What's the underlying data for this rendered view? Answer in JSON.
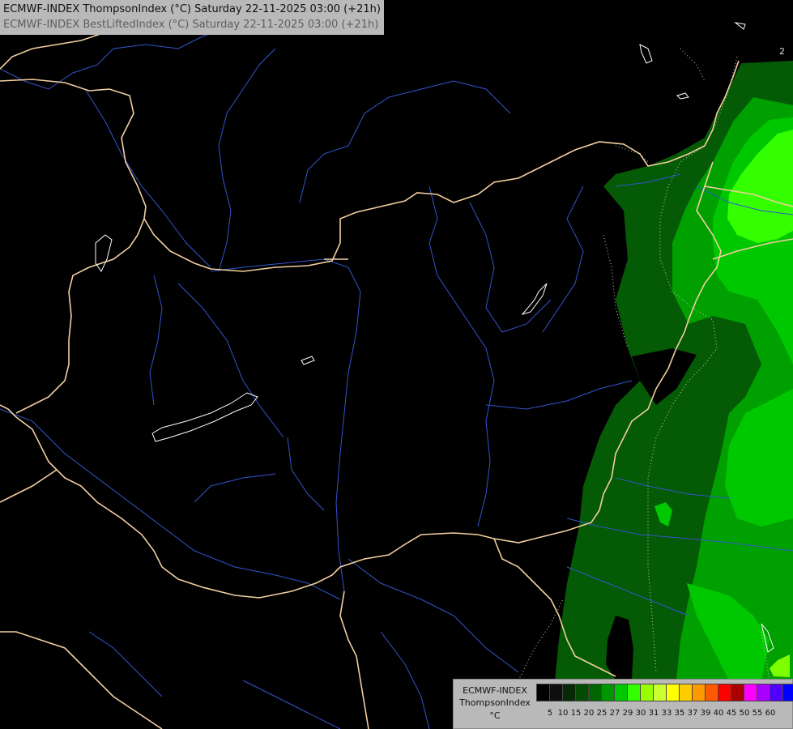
{
  "header": {
    "line1": "ECMWF-INDEX ThompsonIndex (°C) Saturday 22-11-2025 03:00 (+21h)",
    "line2": "ECMWF-INDEX BestLiftedIndex (°C) Saturday 22-11-2025 03:00 (+21h)"
  },
  "map": {
    "background_color": "#000000",
    "border_color": "#f2cfa0",
    "river_color": "#3355cc",
    "lake_outline_color": "#ffffff",
    "contour_label": "2"
  },
  "legend": {
    "source": "ECMWF-INDEX",
    "parameter": "ThompsonIndex",
    "unit": "°C",
    "ticks": [
      "5",
      "10",
      "15",
      "20",
      "25",
      "27",
      "29",
      "30",
      "31",
      "33",
      "35",
      "37",
      "39",
      "40",
      "45",
      "50",
      "55",
      "60"
    ],
    "colors": [
      "#000000",
      "#0e0e0e",
      "#072907",
      "#034a03",
      "#006400",
      "#009600",
      "#00c800",
      "#33ff00",
      "#99ff00",
      "#ccff33",
      "#ffff00",
      "#ffcc00",
      "#ff9900",
      "#ff5a00",
      "#ff0000",
      "#aa0000",
      "#ff00ff",
      "#aa00ff",
      "#5000ff",
      "#0000ff"
    ]
  }
}
